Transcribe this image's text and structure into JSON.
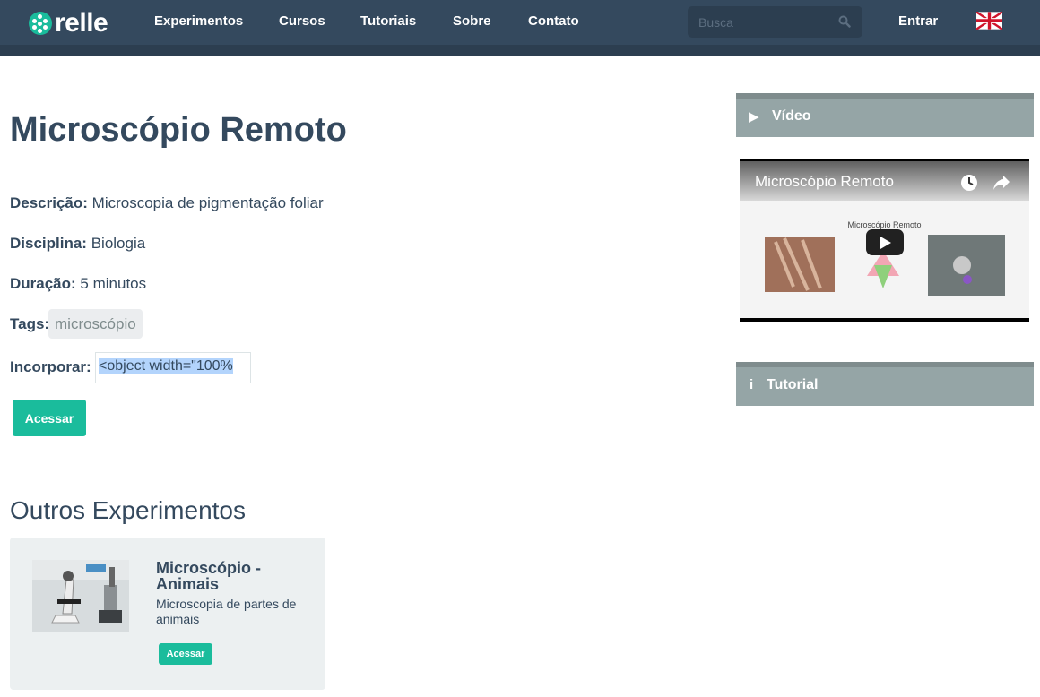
{
  "navbar": {
    "logo_text": "relle",
    "items": [
      "Experimentos",
      "Cursos",
      "Tutoriais",
      "Sobre",
      "Contato"
    ],
    "search_placeholder": "Busca",
    "login_label": "Entrar",
    "language_icon": "uk-flag-icon"
  },
  "experiment": {
    "title": "Microscópio Remoto",
    "description_label": "Descrição:",
    "description": "Microscopia de pigmentação foliar",
    "discipline_label": "Disciplina:",
    "discipline": "Biologia",
    "duration_label": "Duração:",
    "duration": "5 minutos",
    "tags_label": "Tags:",
    "tags": [
      "microscópio"
    ],
    "embed_label": "Incorporar:",
    "embed_code": "<object width=\"100%",
    "access_label": "Acessar"
  },
  "others": {
    "title": "Outros Experimentos",
    "cards": [
      {
        "title": "Microscópio - Animais",
        "description": "Microscopia de partes de animais",
        "access_label": "Acessar"
      }
    ]
  },
  "sidebar": {
    "video_header": "Vídeo",
    "video_title": "Microscópio Remoto",
    "video_slide_title": "Microscópio Remoto",
    "tutorial_header": "Tutorial"
  },
  "colors": {
    "navbar": "#34495e",
    "accent": "#1abc9c",
    "panel_header": "#95a5a6",
    "card_bg": "#ecf0f1"
  }
}
